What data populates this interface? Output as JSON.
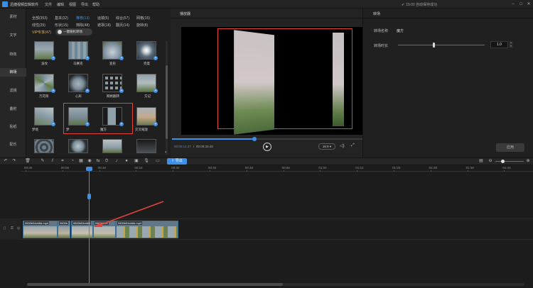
{
  "window": {
    "title": "迅捷视频剪辑软件",
    "menu": [
      "文件",
      "编辑",
      "视图",
      "导出",
      "帮助"
    ],
    "save_status": "15:00 自动保存成功"
  },
  "left_nav": [
    "素材",
    "文字",
    "特效",
    "转场",
    "滤镜",
    "叠附",
    "贴纸",
    "配乐"
  ],
  "resource": {
    "category_tabs": [
      "全部(353)",
      "基本(32)",
      "推荐(13)",
      "运镜(5)",
      "综合(57)",
      "网格(15)",
      "线性(25)",
      "形状(15)",
      "擦除(48)",
      "遮罩(18)",
      "翻页(14)",
      "旋转(8)"
    ],
    "vip_label": "VIP专享(47)",
    "one_click_label": "一键随机转场",
    "thumbnails": [
      "波纹",
      "马赛克",
      "变形",
      "完度",
      "万花筒",
      "心形",
      "网格翻转",
      "方记",
      "梦境",
      "梦",
      "魔方",
      "交叉缩放",
      "",
      "",
      "",
      ""
    ]
  },
  "player": {
    "title": "播放器",
    "time_current": "00:00:14.37",
    "time_sep": "/",
    "time_total": "00:00:33.49",
    "ratio": "16:9",
    "progress": 0.43
  },
  "properties": {
    "title": "转场",
    "name_label": "转场名称",
    "name_value": "魔方",
    "duration_label": "转场时长",
    "duration_value": "1.0",
    "apply_label": "应用"
  },
  "toolbar": {
    "export_label": "导出"
  },
  "timeline": {
    "ticks": [
      "00:00",
      "00:08",
      "00:16",
      "00:24",
      "00:32",
      "00:40",
      "00:48",
      "00:56",
      "01:04",
      "01:12",
      "01:20",
      "01:28",
      "01:36",
      "01:44"
    ],
    "clips": [
      "0600b54cb8d.mp4",
      "0600b",
      "0600b54cb8d",
      "0600b54c",
      "0600b54cb8d.mp4"
    ]
  },
  "colors": {
    "accent": "#3d8fe8",
    "highlight_border": "#e0443a",
    "vip": "#e3b44c"
  }
}
